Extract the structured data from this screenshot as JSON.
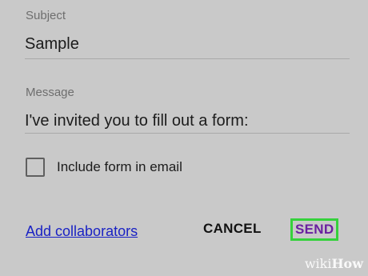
{
  "form": {
    "subject_label": "Subject",
    "subject_value": "Sample",
    "message_label": "Message",
    "message_value": "I've invited you to fill out a form:",
    "include_form_label": "Include form in email",
    "include_form_checked": false
  },
  "actions": {
    "add_collaborators": "Add collaborators",
    "cancel": "CANCEL",
    "send": "SEND"
  },
  "watermark": {
    "text_light": "wiki",
    "text_bold": "How"
  },
  "colors": {
    "background": "#c9c9c9",
    "link": "#1a22c4",
    "send_text": "#6a1fa0",
    "send_highlight": "#35d13c"
  }
}
